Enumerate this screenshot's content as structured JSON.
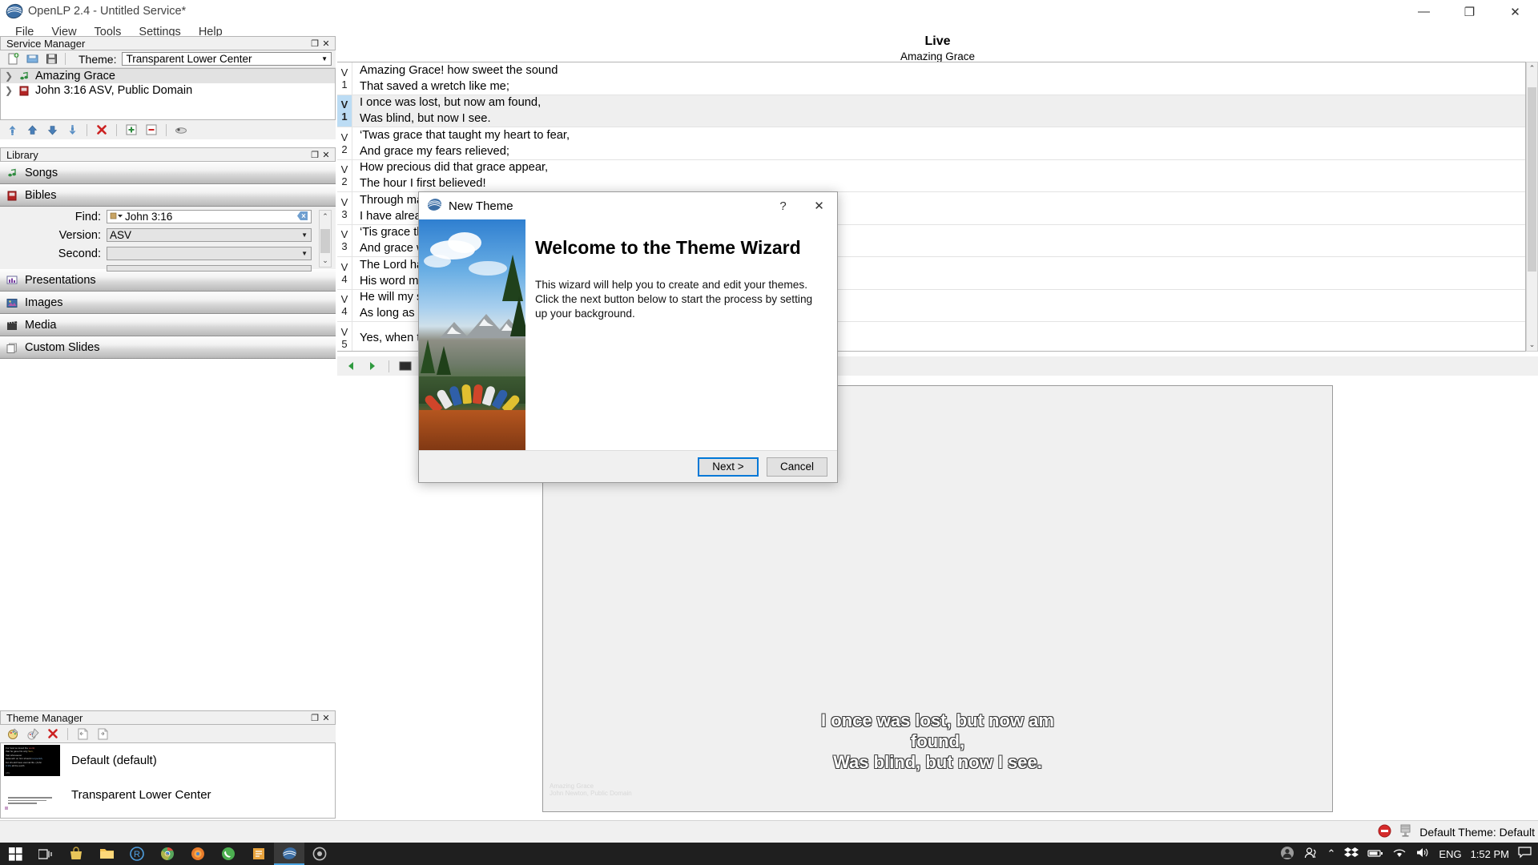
{
  "window": {
    "title": "OpenLP 2.4 - Untitled Service*",
    "logo_icon": "openlp-logo-icon",
    "minimize_icon": "minimize-icon",
    "maximize_icon": "maximize-icon",
    "close_icon": "close-icon",
    "minimize_glyph": "—",
    "maximize_glyph": "❐",
    "close_glyph": "✕"
  },
  "menubar": {
    "items": [
      {
        "label": "File"
      },
      {
        "label": "View"
      },
      {
        "label": "Tools"
      },
      {
        "label": "Settings"
      },
      {
        "label": "Help"
      }
    ]
  },
  "service_manager": {
    "panel_title": "Service Manager",
    "float_glyph": "❐",
    "close_glyph": "✕",
    "toolbar": [
      {
        "name": "new-service-icon",
        "glyph": "🗎"
      },
      {
        "name": "open-service-icon",
        "glyph": "📂"
      },
      {
        "name": "save-service-icon",
        "glyph": "💾"
      }
    ],
    "theme_label": "Theme:",
    "theme_value": "Transparent Lower Center",
    "dropdown_glyph": "▼",
    "items": [
      {
        "label": "Amazing Grace",
        "icon": "music-note-icon",
        "expand_glyph": "❯",
        "selected": true
      },
      {
        "label": "John 3:16 ASV, Public Domain",
        "icon": "bible-book-icon",
        "expand_glyph": "❯",
        "selected": false
      }
    ],
    "bottom_toolbar": [
      {
        "name": "move-to-top-icon",
        "glyph": "⤒"
      },
      {
        "name": "move-up-icon",
        "glyph": "⬆"
      },
      {
        "name": "move-down-icon",
        "glyph": "⬇"
      },
      {
        "name": "move-to-bottom-icon",
        "glyph": "⤓"
      },
      {
        "name": "delete-from-service-icon",
        "glyph": "✖"
      },
      {
        "name": "expand-all-icon",
        "glyph": "➕"
      },
      {
        "name": "collapse-all-icon",
        "glyph": "➖"
      },
      {
        "name": "send-live-icon",
        "glyph": "📽"
      }
    ]
  },
  "library": {
    "panel_title": "Library",
    "float_glyph": "❐",
    "close_glyph": "✕",
    "sections": [
      {
        "label": "Songs",
        "icon": "music-note-icon"
      },
      {
        "label": "Bibles",
        "icon": "bible-book-icon"
      },
      {
        "label": "Presentations",
        "icon": "presentation-chart-icon"
      },
      {
        "label": "Images",
        "icon": "image-icon"
      },
      {
        "label": "Media",
        "icon": "film-clapper-icon"
      },
      {
        "label": "Custom Slides",
        "icon": "custom-slides-icon"
      }
    ],
    "bible_search": {
      "find_label": "Find:",
      "find_value": "John 3:16",
      "find_book_icon": "book-dropdown-icon",
      "clear_icon": "clear-search-icon",
      "version_label": "Version:",
      "version_value": "ASV",
      "second_label": "Second:",
      "second_value": "",
      "scroll_up_glyph": "⌃",
      "scroll_down_glyph": "⌄"
    }
  },
  "theme_manager": {
    "panel_title": "Theme Manager",
    "float_glyph": "❐",
    "close_glyph": "✕",
    "toolbar": [
      {
        "name": "new-theme-icon",
        "glyph": "🎨"
      },
      {
        "name": "edit-theme-icon",
        "glyph": "✎"
      },
      {
        "name": "delete-theme-icon",
        "glyph": "✖"
      },
      {
        "name": "import-theme-icon",
        "glyph": "⮏"
      },
      {
        "name": "export-theme-icon",
        "glyph": "⮎"
      }
    ],
    "themes": [
      {
        "name": "Default (default)",
        "thumb": "dark"
      },
      {
        "name": "Transparent Lower Center",
        "thumb": "light"
      }
    ]
  },
  "live": {
    "title": "Live",
    "subtitle": "Amazing Grace",
    "slides": [
      {
        "verse": "V",
        "num": "1",
        "line1": "Amazing Grace! how sweet the sound",
        "line2": "That saved a wretch like me;",
        "selected": false
      },
      {
        "verse": "V",
        "num": "1",
        "line1": "I once was lost, but now am found,",
        "line2": "Was blind, but now I see.",
        "selected": true
      },
      {
        "verse": "V",
        "num": "2",
        "line1": "‘Twas grace that taught my heart to fear,",
        "line2": "And grace my fears relieved;",
        "selected": false
      },
      {
        "verse": "V",
        "num": "2",
        "line1": "How precious did that grace appear,",
        "line2": "The hour I first believed!",
        "selected": false
      },
      {
        "verse": "V",
        "num": "3",
        "line1": "Through many dangers, toils and snares,",
        "line2": "I have already come;",
        "selected": false
      },
      {
        "verse": "V",
        "num": "3",
        "line1": "‘Tis grace that brought me safe thus far,",
        "line2": "And grace will lead me home.",
        "selected": false
      },
      {
        "verse": "V",
        "num": "4",
        "line1": "The Lord has promised good to me,",
        "line2": "His word my hope secures;",
        "selected": false
      },
      {
        "verse": "V",
        "num": "4",
        "line1": "He will my shield and portion be,",
        "line2": "As long as life endures.",
        "selected": false
      },
      {
        "verse": "V",
        "num": "5",
        "line1": "Yes, when this heart and flesh shall fail,",
        "line2": "",
        "selected": false
      }
    ],
    "controls": [
      {
        "name": "previous-slide-icon",
        "glyph": "◀"
      },
      {
        "name": "play-slideshow-icon",
        "glyph": "▶"
      },
      {
        "name": "blank-screen-icon",
        "glyph": "⬛"
      },
      {
        "name": "blank-to-theme-icon",
        "glyph": "⬜"
      },
      {
        "name": "desktop-icon",
        "glyph": "▤"
      }
    ],
    "preview": {
      "line1": "I once was lost, but now am",
      "line2": "found,",
      "line3": "Was blind, but now I see.",
      "credit1": "Amazing Grace",
      "credit2": "John Newton, Public Domain"
    }
  },
  "statusbar": {
    "blank_icon": "blank-screen-status-icon",
    "desktop_icon": "desktop-status-icon",
    "theme_text": "Default Theme: Default"
  },
  "dialog": {
    "title": "New Theme",
    "logo_icon": "openlp-logo-icon",
    "help_glyph": "?",
    "close_glyph": "✕",
    "heading": "Welcome to the Theme Wizard",
    "paragraph": "This wizard will help you to create and edit your themes. Click the next button below to start the process by setting up your background.",
    "next_label": "Next >",
    "cancel_label": "Cancel"
  },
  "taskbar": {
    "items": [
      {
        "name": "start-button-icon",
        "glyph": "⊞",
        "color": "#ffffff"
      },
      {
        "name": "task-view-icon",
        "glyph": "⌸",
        "color": "#ffffff"
      },
      {
        "name": "store-icon",
        "glyph": "🛍",
        "color": "#e8c55a"
      },
      {
        "name": "file-explorer-icon",
        "glyph": "📁",
        "color": "#f5c452"
      },
      {
        "name": "r-studio-icon",
        "glyph": "R",
        "color": "#4f9fe0"
      },
      {
        "name": "chrome-icon",
        "glyph": "◉",
        "color": "#58a55c"
      },
      {
        "name": "firefox-icon",
        "glyph": "●",
        "color": "#e87b2a"
      },
      {
        "name": "whatsapp-icon",
        "glyph": "●",
        "color": "#4caf50"
      },
      {
        "name": "editor-icon",
        "glyph": "■",
        "color": "#e8a33d"
      },
      {
        "name": "openlp-taskbar-icon",
        "glyph": "◕",
        "color": "#5a8fc0"
      },
      {
        "name": "app-icon",
        "glyph": "◎",
        "color": "#bdbdbd"
      }
    ],
    "tray": {
      "user_icon": "user-account-icon",
      "people_icon": "people-icon",
      "chevron_glyph": "⌃",
      "dropbox_icon": "dropbox-icon",
      "battery_icon": "battery-icon",
      "wifi_icon": "wifi-icon",
      "volume_icon": "volume-icon",
      "language": "ENG",
      "time": "1:52 PM",
      "notification_icon": "notification-icon"
    }
  }
}
